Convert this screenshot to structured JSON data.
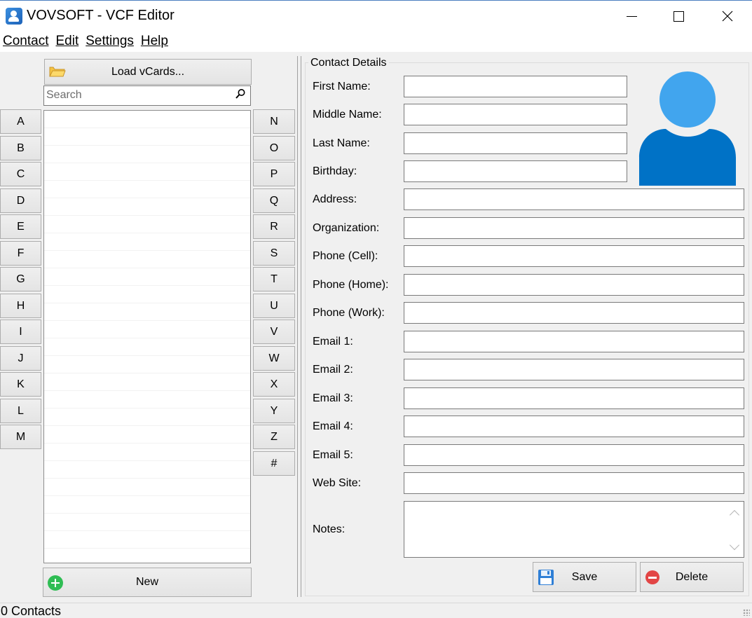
{
  "window": {
    "title": "VOVSOFT - VCF Editor"
  },
  "menu": [
    {
      "label": "Contact"
    },
    {
      "label": "Edit"
    },
    {
      "label": "Settings"
    },
    {
      "label": "Help"
    }
  ],
  "left": {
    "load_label": "Load vCards...",
    "search_placeholder": "Search",
    "new_label": "New",
    "letters_left": [
      "A",
      "B",
      "C",
      "D",
      "E",
      "F",
      "G",
      "H",
      "I",
      "J",
      "K",
      "L",
      "M"
    ],
    "letters_right": [
      "N",
      "O",
      "P",
      "Q",
      "R",
      "S",
      "T",
      "U",
      "V",
      "W",
      "X",
      "Y",
      "Z",
      "#"
    ]
  },
  "details": {
    "group_title": "Contact Details",
    "fields": {
      "first_name": {
        "label": "First Name:",
        "value": ""
      },
      "middle_name": {
        "label": "Middle Name:",
        "value": ""
      },
      "last_name": {
        "label": "Last Name:",
        "value": ""
      },
      "birthday": {
        "label": "Birthday:",
        "value": ""
      },
      "address": {
        "label": "Address:",
        "value": ""
      },
      "organization": {
        "label": "Organization:",
        "value": ""
      },
      "phone_cell": {
        "label": "Phone (Cell):",
        "value": ""
      },
      "phone_home": {
        "label": "Phone (Home):",
        "value": ""
      },
      "phone_work": {
        "label": "Phone (Work):",
        "value": ""
      },
      "email1": {
        "label": "Email 1:",
        "value": ""
      },
      "email2": {
        "label": "Email 2:",
        "value": ""
      },
      "email3": {
        "label": "Email 3:",
        "value": ""
      },
      "email4": {
        "label": "Email 4:",
        "value": ""
      },
      "email5": {
        "label": "Email 5:",
        "value": ""
      },
      "website": {
        "label": "Web Site:",
        "value": ""
      },
      "notes": {
        "label": "Notes:",
        "value": ""
      }
    },
    "save_label": "Save",
    "delete_label": "Delete"
  },
  "status": {
    "text": "0 Contacts"
  },
  "colors": {
    "avatar_head": "#41a5ee",
    "avatar_body": "#0072c6",
    "accent": "#4a7fbf"
  }
}
